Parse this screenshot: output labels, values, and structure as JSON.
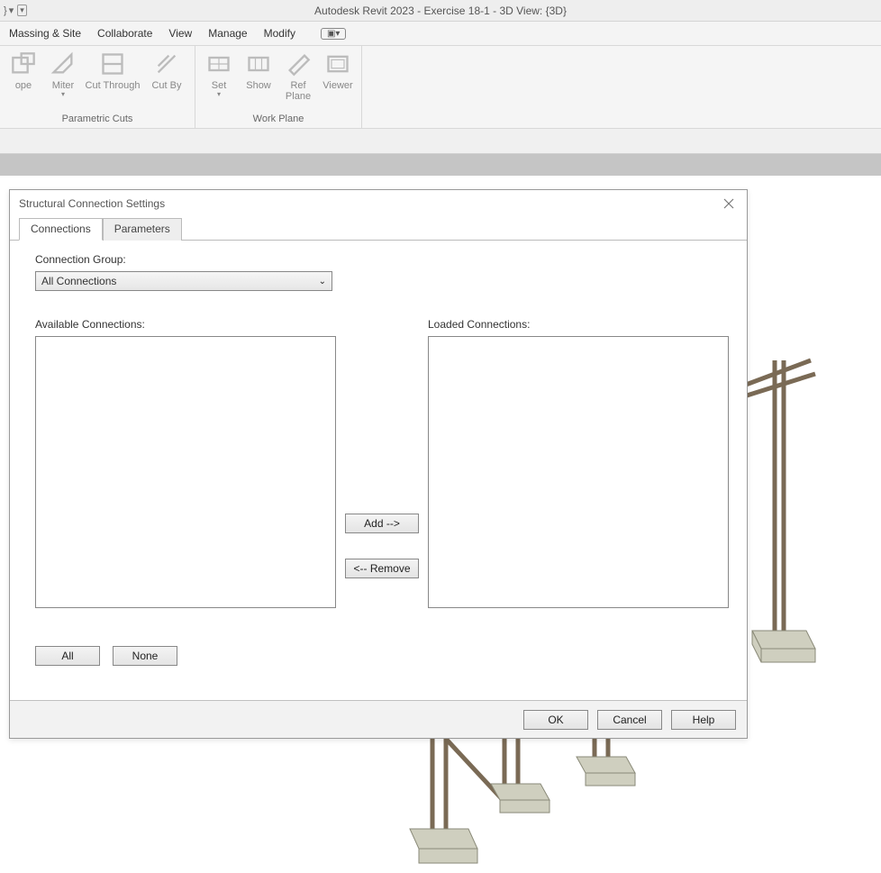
{
  "app": {
    "title": "Autodesk Revit 2023 - Exercise 18-1 - 3D View: {3D}"
  },
  "tabs": {
    "massing": "Massing & Site",
    "collaborate": "Collaborate",
    "view": "View",
    "manage": "Manage",
    "modify": "Modify"
  },
  "ribbon": {
    "group1": {
      "cope": "ope",
      "miter": "Miter",
      "cutthrough": "Cut Through",
      "cutby": "Cut By",
      "label": "Parametric Cuts"
    },
    "group2": {
      "set": "Set",
      "show": "Show",
      "refplane_a": "Ref",
      "refplane_b": "Plane",
      "viewer": "Viewer",
      "label": "Work Plane"
    }
  },
  "dialog": {
    "title": "Structural Connection Settings",
    "tabs": {
      "connections": "Connections",
      "parameters": "Parameters"
    },
    "connGroupLabel": "Connection Group:",
    "connGroupValue": "All Connections",
    "availLabel": "Available Connections:",
    "loadedLabel": "Loaded Connections:",
    "addBtn": "Add -->",
    "removeBtn": "<-- Remove",
    "allBtn": "All",
    "noneBtn": "None",
    "okBtn": "OK",
    "cancelBtn": "Cancel",
    "helpBtn": "Help"
  }
}
